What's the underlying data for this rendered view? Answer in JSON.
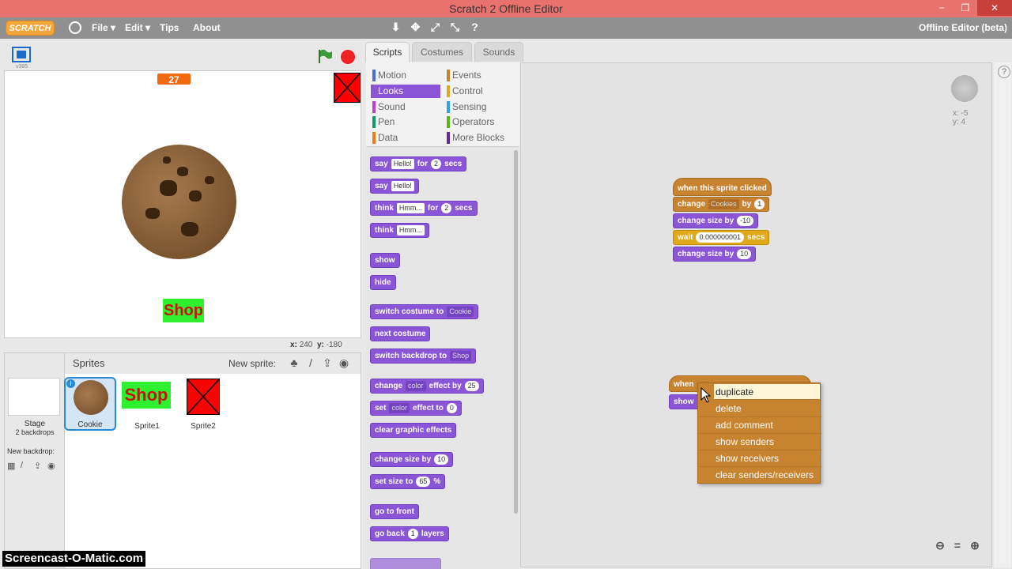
{
  "window": {
    "title": "Scratch 2 Offline Editor",
    "controls": [
      "−",
      "❐",
      "✕"
    ]
  },
  "menubar": {
    "logo": "SCRATCH",
    "items": [
      "File ▾",
      "Edit ▾",
      "Tips",
      "About"
    ],
    "mode": "Offline Editor (beta)"
  },
  "stage": {
    "version": "v385",
    "score": "27",
    "shop_label": "Shop",
    "coords_x_label": "x:",
    "coords_x": "240",
    "coords_y_label": "y:",
    "coords_y": "-180"
  },
  "sprites": {
    "title": "Sprites",
    "new_sprite": "New sprite:",
    "stage_label": "Stage",
    "stage_sub": "2 backdrops",
    "new_backdrop": "New backdrop:",
    "items": [
      {
        "name": "Cookie",
        "selected": true
      },
      {
        "name": "Sprite1",
        "text": "Shop"
      },
      {
        "name": "Sprite2"
      }
    ]
  },
  "tabs": [
    "Scripts",
    "Costumes",
    "Sounds"
  ],
  "categories": [
    {
      "label": "Motion",
      "color": "#4a6cd4"
    },
    {
      "label": "Looks",
      "color": "#8a55d7"
    },
    {
      "label": "Sound",
      "color": "#bb42c3"
    },
    {
      "label": "Pen",
      "color": "#0e9a6c"
    },
    {
      "label": "Data",
      "color": "#ee7d16"
    },
    {
      "label": "Events",
      "color": "#c88330"
    },
    {
      "label": "Control",
      "color": "#e1a91a"
    },
    {
      "label": "Sensing",
      "color": "#2ca5e2"
    },
    {
      "label": "Operators",
      "color": "#5cb712"
    },
    {
      "label": "More Blocks",
      "color": "#632d99"
    }
  ],
  "palette": {
    "say_for": [
      "say",
      "Hello!",
      "for",
      "2",
      "secs"
    ],
    "say": [
      "say",
      "Hello!"
    ],
    "think_for": [
      "think",
      "Hmm...",
      "for",
      "2",
      "secs"
    ],
    "think": [
      "think",
      "Hmm..."
    ],
    "show": "show",
    "hide": "hide",
    "switch_costume": [
      "switch costume to",
      "Cookie"
    ],
    "next_costume": "next costume",
    "switch_backdrop": [
      "switch backdrop to",
      "Shop"
    ],
    "change_effect": [
      "change",
      "color",
      "effect by",
      "25"
    ],
    "set_effect": [
      "set",
      "color",
      "effect to",
      "0"
    ],
    "clear_effects": "clear graphic effects",
    "change_size": [
      "change size by",
      "10"
    ],
    "set_size": [
      "set size to",
      "65",
      "%"
    ],
    "go_front": "go to front",
    "go_back": [
      "go back",
      "1",
      "layers"
    ]
  },
  "script": {
    "hat": "when this sprite clicked",
    "change_var": [
      "change",
      "Cookies",
      "by",
      "1"
    ],
    "change_size_neg": [
      "change size by",
      "-10"
    ],
    "wait": [
      "wait",
      "0.000000001",
      "secs"
    ],
    "change_size_pos": [
      "change size by",
      "10"
    ],
    "partial_hat": "when",
    "partial_show": "show"
  },
  "sprite_xy": {
    "x": "x: -5",
    "y": "y: 4"
  },
  "context_menu": [
    "duplicate",
    "delete",
    "add comment",
    "show senders",
    "show receivers",
    "clear senders/receivers"
  ],
  "watermark": "Screencast-O-Matic.com"
}
